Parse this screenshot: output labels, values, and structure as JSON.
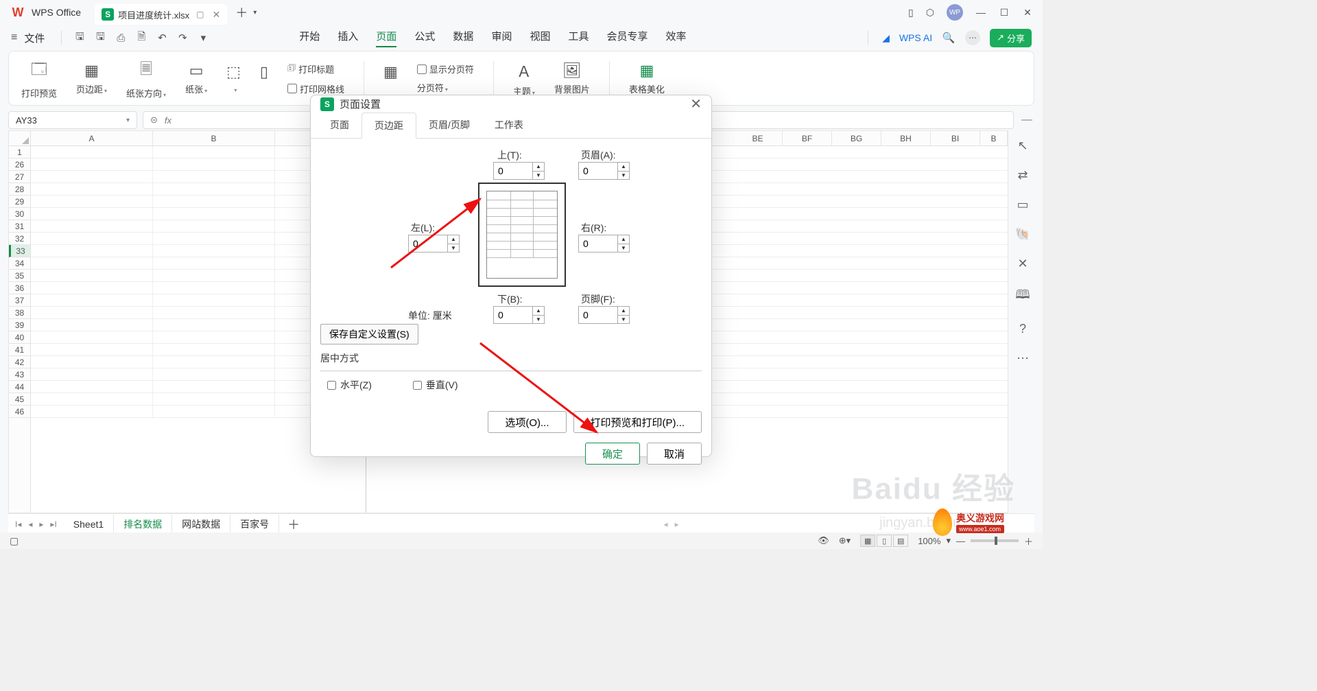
{
  "app": {
    "name": "WPS Office"
  },
  "tab": {
    "filename": "项目进度统计.xlsx"
  },
  "menubar": {
    "file": "文件"
  },
  "menu_tabs": [
    "开始",
    "插入",
    "页面",
    "公式",
    "数据",
    "审阅",
    "视图",
    "工具",
    "会员专享",
    "效率"
  ],
  "menu_active_index": 2,
  "ai_label": "WPS AI",
  "share_label": "分享",
  "ribbon": {
    "print_preview": "打印预览",
    "margins": "页边距",
    "orientation": "纸张方向",
    "paper": "纸张",
    "print_titles": "打印标题",
    "print_gridlines": "打印网格线",
    "show_page_breaks": "显示分页符",
    "page_breaks": "分页符",
    "theme": "主题",
    "bg_image": "背景图片",
    "beautify": "表格美化"
  },
  "namebox": "AY33",
  "fx_label": "fx",
  "columns": [
    "A",
    "B",
    "BE",
    "BF",
    "BG",
    "BH",
    "BI",
    "B"
  ],
  "rows_first": "1",
  "rows": [
    "26",
    "27",
    "28",
    "29",
    "30",
    "31",
    "32",
    "33",
    "34",
    "35",
    "36",
    "37",
    "38",
    "39",
    "40",
    "41",
    "42",
    "43",
    "44",
    "45",
    "46"
  ],
  "active_row": "33",
  "sheet_tabs": [
    "Sheet1",
    "排名数据",
    "网站数据",
    "百家号"
  ],
  "sheet_active_index": 1,
  "zoom": "100%",
  "dialog": {
    "title": "页面设置",
    "tabs": [
      "页面",
      "页边距",
      "页眉/页脚",
      "工作表"
    ],
    "active_tab_index": 1,
    "top_label": "上(T):",
    "header_label": "页眉(A):",
    "left_label": "左(L):",
    "right_label": "右(R):",
    "bottom_label": "下(B):",
    "footer_label": "页脚(F):",
    "unit_label": "单位:",
    "unit_value": "厘米",
    "top_v": "0",
    "header_v": "0",
    "left_v": "0",
    "right_v": "0",
    "bottom_v": "0",
    "footer_v": "0",
    "save": "保存自定义设置(S)",
    "center_label": "居中方式",
    "horizontal": "水平(Z)",
    "vertical": "垂直(V)",
    "options": "选项(O)...",
    "print_preview": "打印预览和打印(P)...",
    "ok": "确定",
    "cancel": "取消"
  },
  "watermark": {
    "line1": "Baidu 经验",
    "line2": "jingyan.baidu"
  },
  "brand": {
    "cn": "奥义游戏网",
    "en": "www.aoe1.com"
  }
}
